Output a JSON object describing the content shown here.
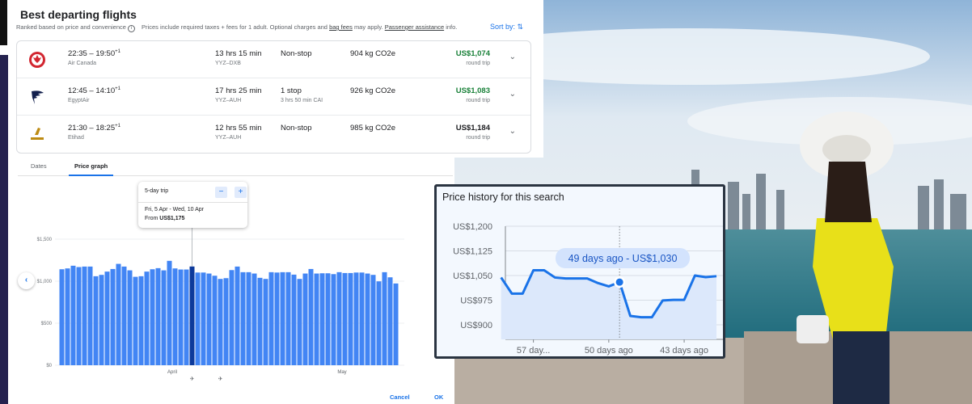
{
  "flights": {
    "title": "Best departing flights",
    "subtitle": "Ranked based on price and convenience",
    "info_text": "Prices include required taxes + fees for 1 adult. Optional charges and",
    "bag_fees": "bag fees",
    "may_apply": "may apply.",
    "passenger_assistance": "Passenger assistance",
    "info_suffix": "info.",
    "sort_label": "Sort by:",
    "rows": [
      {
        "time": "22:35 – 19:50",
        "plus": "+1",
        "airline": "Air Canada",
        "duration": "13 hrs 15 min",
        "route": "YYZ–DXB",
        "stops": "Non-stop",
        "stop_detail": "",
        "co2": "904 kg CO2e",
        "price": "US$1,074",
        "price_note": "round trip",
        "price_color": "#188038"
      },
      {
        "time": "12:45 – 14:10",
        "plus": "+1",
        "airline": "EgyptAir",
        "duration": "17 hrs 25 min",
        "route": "YYZ–AUH",
        "stops": "1 stop",
        "stop_detail": "3 hrs 50 min CAI",
        "co2": "926 kg CO2e",
        "price": "US$1,083",
        "price_note": "round trip",
        "price_color": "#188038"
      },
      {
        "time": "21:30 – 18:25",
        "plus": "+1",
        "airline": "Etihad",
        "duration": "12 hrs 55 min",
        "route": "YYZ–AUH",
        "stops": "Non-stop",
        "stop_detail": "",
        "co2": "985 kg CO2e",
        "price": "US$1,184",
        "price_note": "round trip",
        "price_color": "#202124"
      }
    ]
  },
  "tabs": [
    {
      "label": "Dates"
    },
    {
      "label": "Price graph"
    }
  ],
  "tooltip": {
    "trip": "5-day trip",
    "minus": "−",
    "plus": "+",
    "dates": "Fri, 5 Apr - Wed, 10 Apr",
    "from": "From",
    "price": "US$1,175"
  },
  "footer": {
    "cancel": "Cancel",
    "ok": "OK"
  },
  "chart_data": [
    {
      "type": "bar",
      "title": "Price graph",
      "yticks": [
        "$0",
        "$500",
        "$1,000",
        "$1,500"
      ],
      "ylim": [
        0,
        1500
      ],
      "month_labels": [
        "April",
        "May"
      ],
      "month_positions": [
        20,
        50
      ],
      "selected_index": 23,
      "values": [
        1142,
        1152,
        1184,
        1168,
        1174,
        1174,
        1059,
        1075,
        1114,
        1145,
        1206,
        1174,
        1129,
        1052,
        1059,
        1114,
        1142,
        1155,
        1129,
        1242,
        1152,
        1139,
        1139,
        1175,
        1103,
        1103,
        1091,
        1065,
        1027,
        1036,
        1132,
        1174,
        1107,
        1107,
        1091,
        1040,
        1027,
        1107,
        1103,
        1107,
        1107,
        1078,
        1027,
        1091,
        1145,
        1091,
        1094,
        1094,
        1084,
        1107,
        1097,
        1097,
        1103,
        1103,
        1091,
        1075,
        998,
        1107,
        1046,
        973
      ]
    },
    {
      "type": "line",
      "title": "Price history for this search",
      "ylabel": "",
      "ylim": [
        875,
        1200
      ],
      "yticks": [
        "US$900",
        "US$975",
        "US$1,050",
        "US$1,125",
        "US$1,200"
      ],
      "ytick_values": [
        900,
        975,
        1050,
        1125,
        1200
      ],
      "xticks": [
        "57 day...",
        "50 days ago",
        "43 days ago"
      ],
      "xtick_values": [
        57,
        50,
        43
      ],
      "xlim": [
        59.6,
        39.4
      ],
      "x": [
        60,
        59,
        58,
        57,
        56,
        55,
        54,
        53,
        52,
        51,
        50,
        49,
        48,
        47,
        46,
        45,
        44,
        43,
        42,
        41,
        40
      ],
      "y": [
        1044,
        995,
        995,
        1066,
        1066,
        1044,
        1041,
        1041,
        1041,
        1027,
        1017,
        1030,
        927,
        923,
        923,
        974,
        976,
        976,
        1050,
        1045,
        1048
      ],
      "highlight": {
        "x": 49,
        "y": 1030,
        "label": "49 days ago - US$1,030"
      }
    }
  ],
  "colors": {
    "bar": "#4285f4",
    "bar_selected": "#0d3a9b",
    "accent": "#1a73e8"
  }
}
